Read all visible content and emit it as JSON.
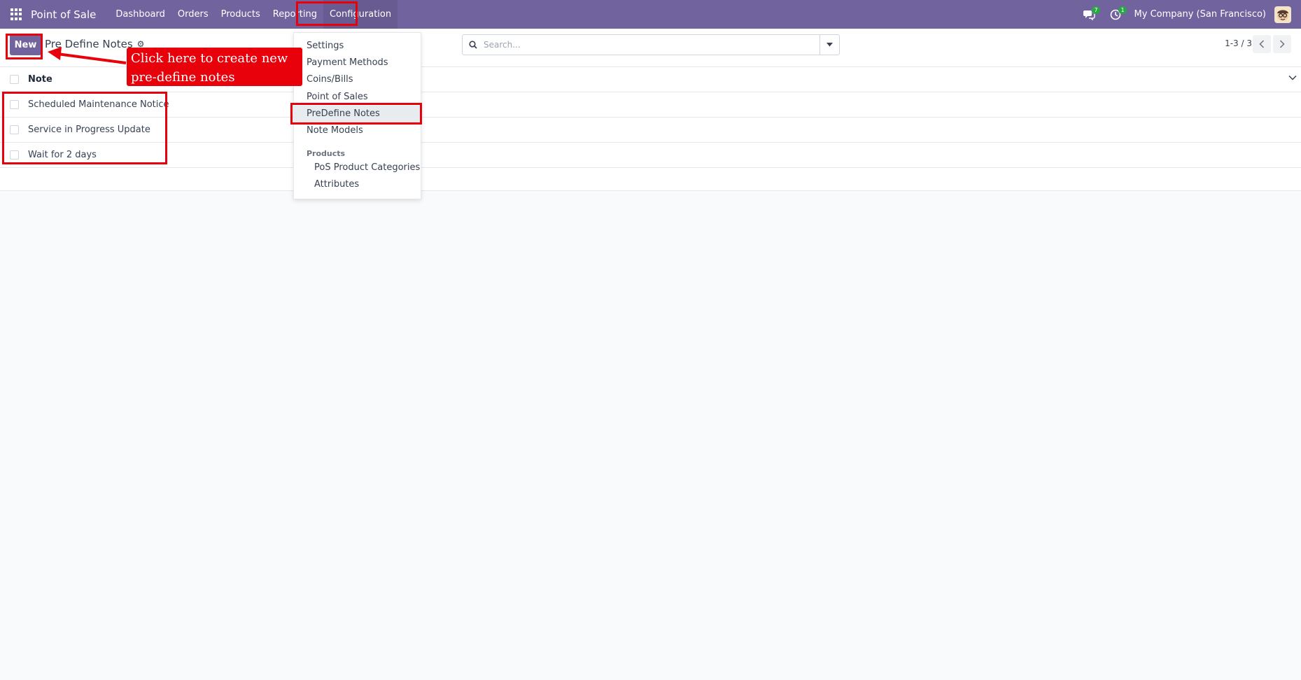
{
  "navbar": {
    "app_name": "Point of Sale",
    "menu": [
      "Dashboard",
      "Orders",
      "Products",
      "Reporting",
      "Configuration"
    ],
    "messages_count": "7",
    "activities_count": "1",
    "company": "My Company (San Francisco)"
  },
  "control_panel": {
    "new_label": "New",
    "breadcrumb": "Pre Define Notes",
    "search_placeholder": "Search...",
    "pager": "1-3 / 3"
  },
  "list": {
    "column_header": "Note",
    "rows": [
      "Scheduled Maintenance Notice",
      "Service in Progress Update",
      "Wait for 2 days"
    ]
  },
  "config_menu": {
    "items": [
      "Settings",
      "Payment Methods",
      "Coins/Bills",
      "Point of Sales",
      "PreDefine Notes",
      "Note Models"
    ],
    "products_header": "Products",
    "product_items": [
      "PoS Product Categories",
      "Attributes"
    ]
  },
  "annotation": {
    "line1": "Click here to create new",
    "line2": "pre-define notes"
  },
  "colors": {
    "brand": "#71639e",
    "highlight_red": "#e8000b",
    "badge_green": "#28a745"
  }
}
